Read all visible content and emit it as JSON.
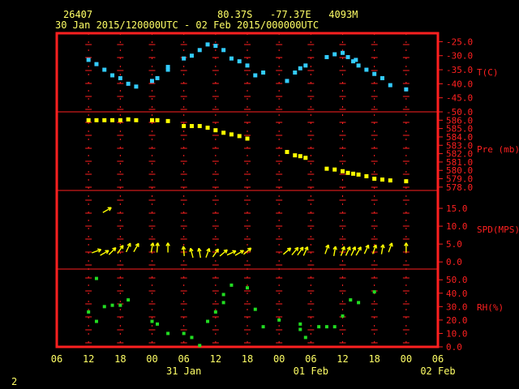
{
  "header": {
    "station_id": "26407",
    "coords": "80.37S   -77.37E   4093M",
    "time_range": "30 Jan 2015/120000UTC - 02 Feb 2015/000000UTC"
  },
  "footer": {
    "page_number": "2"
  },
  "colors": {
    "frame": "#ff2020",
    "text": "#ffff66",
    "axis_text": "#ff2020",
    "temp": "#33ccff",
    "pres": "#ffff00",
    "wind": "#ffff00",
    "rh": "#22dd22"
  },
  "chart_data": {
    "type": "scatter",
    "x_axis": {
      "unit": "hours since 30 Jan 2015 12 UTC",
      "range": [
        -6,
        66
      ],
      "tick_labels": [
        {
          "x": -6,
          "label": "06"
        },
        {
          "x": 0,
          "label": "12"
        },
        {
          "x": 6,
          "label": "18"
        },
        {
          "x": 12,
          "label": "00"
        },
        {
          "x": 18,
          "label": "06"
        },
        {
          "x": 24,
          "label": "12"
        },
        {
          "x": 30,
          "label": "18"
        },
        {
          "x": 36,
          "label": "00"
        },
        {
          "x": 42,
          "label": "06"
        },
        {
          "x": 48,
          "label": "12"
        },
        {
          "x": 54,
          "label": "18"
        },
        {
          "x": 60,
          "label": "00"
        },
        {
          "x": 66,
          "label": "06"
        }
      ],
      "date_labels": [
        {
          "x": 18,
          "label": "31 Jan"
        },
        {
          "x": 42,
          "label": "01 Feb"
        },
        {
          "x": 66,
          "label": "02 Feb"
        }
      ]
    },
    "panels": [
      {
        "id": "temp",
        "label": "T(C)",
        "ylim": [
          -50,
          -22
        ],
        "ticks": [
          -25,
          -30,
          -35,
          -40,
          -45,
          -50
        ],
        "tick_labels": [
          "-25.0",
          "-30.0",
          "-35.0",
          "-40.0",
          "-45.0",
          "-50.0"
        ],
        "points": [
          [
            0,
            -31.5
          ],
          [
            1.5,
            -33
          ],
          [
            3,
            -35
          ],
          [
            4.5,
            -37
          ],
          [
            6,
            -38
          ],
          [
            7.5,
            -40
          ],
          [
            9,
            -41
          ],
          [
            12,
            -39
          ],
          [
            13,
            -38
          ],
          [
            15,
            -34
          ],
          [
            15,
            -35
          ],
          [
            18,
            -31
          ],
          [
            19.5,
            -30
          ],
          [
            21,
            -28
          ],
          [
            22.5,
            -26
          ],
          [
            24,
            -26.5
          ],
          [
            25.5,
            -28
          ],
          [
            27,
            -31
          ],
          [
            28.5,
            -32
          ],
          [
            30,
            -33.5
          ],
          [
            31.5,
            -37
          ],
          [
            33,
            -36
          ],
          [
            37.5,
            -39
          ],
          [
            39,
            -36
          ],
          [
            40,
            -34.5
          ],
          [
            41,
            -33.5
          ],
          [
            45,
            -30.5
          ],
          [
            46.5,
            -29.5
          ],
          [
            48,
            -29
          ],
          [
            49,
            -30.5
          ],
          [
            50,
            -32
          ],
          [
            50.5,
            -31.5
          ],
          [
            51,
            -33.5
          ],
          [
            52.5,
            -35
          ],
          [
            54,
            -36.5
          ],
          [
            55.5,
            -38
          ],
          [
            57,
            -40.5
          ],
          [
            60,
            -42
          ]
        ]
      },
      {
        "id": "pres",
        "label": "Pre (mb)",
        "ylim": [
          577.6,
          587
        ],
        "ticks": [
          586,
          585,
          584,
          583,
          582,
          581,
          580,
          579,
          578
        ],
        "tick_labels": [
          "586.0",
          "585.0",
          "584.0",
          "583.0",
          "582.0",
          "581.0",
          "580.0",
          "579.0",
          "578.0"
        ],
        "points": [
          [
            0,
            586
          ],
          [
            1.5,
            586
          ],
          [
            3,
            586
          ],
          [
            4.5,
            586
          ],
          [
            6,
            586
          ],
          [
            7.5,
            586.1
          ],
          [
            9,
            586
          ],
          [
            12,
            586
          ],
          [
            13,
            586
          ],
          [
            15,
            585.9
          ],
          [
            18,
            585.3
          ],
          [
            19.5,
            585.3
          ],
          [
            21,
            585.3
          ],
          [
            22.5,
            585.1
          ],
          [
            24,
            584.8
          ],
          [
            25.5,
            584.5
          ],
          [
            27,
            584.3
          ],
          [
            28.5,
            584.1
          ],
          [
            30,
            583.8
          ],
          [
            37.5,
            582.2
          ],
          [
            39,
            581.8
          ],
          [
            40,
            581.7
          ],
          [
            41,
            581.5
          ],
          [
            45,
            580.2
          ],
          [
            46.5,
            580.1
          ],
          [
            48,
            579.9
          ],
          [
            49,
            579.7
          ],
          [
            50,
            579.6
          ],
          [
            51,
            579.5
          ],
          [
            52.5,
            579.3
          ],
          [
            54,
            579
          ],
          [
            55.5,
            578.9
          ],
          [
            57,
            578.8
          ],
          [
            60,
            578.7
          ]
        ]
      },
      {
        "id": "wind",
        "label": "SPD(MPS)",
        "ylim": [
          -2,
          20
        ],
        "ticks": [
          15,
          10,
          5,
          0
        ],
        "tick_labels": [
          "15.0",
          "10.0",
          "5.0",
          "0.0"
        ],
        "barbs": [
          {
            "x": 1.5,
            "spd": 3,
            "dir": 250
          },
          {
            "x": 3,
            "spd": 2.5,
            "dir": 240
          },
          {
            "x": 3.5,
            "spd": 14.5,
            "dir": 240
          },
          {
            "x": 4.5,
            "spd": 3,
            "dir": 225
          },
          {
            "x": 6,
            "spd": 3.5,
            "dir": 215
          },
          {
            "x": 7.5,
            "spd": 4,
            "dir": 205
          },
          {
            "x": 9,
            "spd": 4,
            "dir": 210
          },
          {
            "x": 12,
            "spd": 4,
            "dir": 190
          },
          {
            "x": 13,
            "spd": 4,
            "dir": 185
          },
          {
            "x": 15,
            "spd": 4,
            "dir": 180
          },
          {
            "x": 18,
            "spd": 3,
            "dir": 175
          },
          {
            "x": 19.5,
            "spd": 2.5,
            "dir": 165
          },
          {
            "x": 21,
            "spd": 2.5,
            "dir": 170
          },
          {
            "x": 22.5,
            "spd": 2.5,
            "dir": 200
          },
          {
            "x": 24,
            "spd": 2.5,
            "dir": 215
          },
          {
            "x": 25.5,
            "spd": 2.5,
            "dir": 230
          },
          {
            "x": 27,
            "spd": 2.5,
            "dir": 245
          },
          {
            "x": 28.5,
            "spd": 2.5,
            "dir": 240
          },
          {
            "x": 30,
            "spd": 3,
            "dir": 230
          },
          {
            "x": 37.5,
            "spd": 3,
            "dir": 230
          },
          {
            "x": 39,
            "spd": 3,
            "dir": 220
          },
          {
            "x": 40,
            "spd": 3,
            "dir": 215
          },
          {
            "x": 41,
            "spd": 3,
            "dir": 205
          },
          {
            "x": 45,
            "spd": 3.5,
            "dir": 200
          },
          {
            "x": 46.5,
            "spd": 3,
            "dir": 190
          },
          {
            "x": 48,
            "spd": 3,
            "dir": 200
          },
          {
            "x": 49,
            "spd": 3,
            "dir": 205
          },
          {
            "x": 50,
            "spd": 3,
            "dir": 205
          },
          {
            "x": 51,
            "spd": 3,
            "dir": 210
          },
          {
            "x": 52.5,
            "spd": 3.5,
            "dir": 205
          },
          {
            "x": 54,
            "spd": 3.5,
            "dir": 200
          },
          {
            "x": 55.5,
            "spd": 3.5,
            "dir": 190
          },
          {
            "x": 57,
            "spd": 4,
            "dir": 200
          },
          {
            "x": 60,
            "spd": 4,
            "dir": 180
          }
        ]
      },
      {
        "id": "rh",
        "label": "RH(%)",
        "ylim": [
          0,
          58
        ],
        "ticks": [
          50,
          40,
          30,
          20,
          10,
          0
        ],
        "tick_labels": [
          "50.0",
          "40.0",
          "30.0",
          "20.0",
          "10.0",
          "0.0"
        ],
        "points": [
          [
            0,
            26
          ],
          [
            1.5,
            51
          ],
          [
            1.5,
            19
          ],
          [
            3,
            30
          ],
          [
            4.5,
            31
          ],
          [
            6,
            31
          ],
          [
            7.5,
            35
          ],
          [
            12,
            19
          ],
          [
            13,
            17
          ],
          [
            15,
            10
          ],
          [
            18,
            10
          ],
          [
            19.5,
            7
          ],
          [
            21,
            1
          ],
          [
            22.5,
            19
          ],
          [
            24,
            26
          ],
          [
            25.5,
            33
          ],
          [
            25.5,
            39
          ],
          [
            27,
            46
          ],
          [
            30,
            44
          ],
          [
            31.5,
            28
          ],
          [
            33,
            15
          ],
          [
            36,
            20
          ],
          [
            40,
            17
          ],
          [
            40,
            13
          ],
          [
            41,
            7
          ],
          [
            43.5,
            15
          ],
          [
            45,
            15
          ],
          [
            46.5,
            15
          ],
          [
            48,
            23
          ],
          [
            49.5,
            35
          ],
          [
            51,
            33
          ],
          [
            54,
            41
          ]
        ]
      }
    ]
  }
}
